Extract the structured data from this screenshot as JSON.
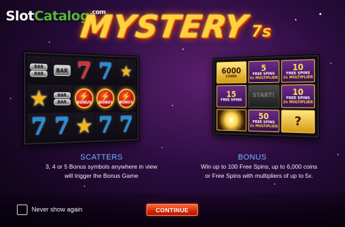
{
  "watermark": {
    "part1": "Slot",
    "part2": "Catalog",
    "part3": ".com"
  },
  "logo": {
    "title": "MYSTERY",
    "suffix": "7s"
  },
  "reels": {
    "bar_label": "BAR",
    "bonus_label": "BONUS"
  },
  "bonus_board": {
    "tiles": [
      {
        "big": "6000",
        "small": "COINS"
      },
      {
        "big": "5",
        "small": "FREE SPINS",
        "mult": "5x MULTIPLIER"
      },
      {
        "big": "10",
        "small": "FREE SPINS",
        "mult": "2x MULTIPLIER"
      },
      {
        "big": "15",
        "small": "FREE SPINS"
      },
      {
        "big": "START!"
      },
      {
        "big": "10",
        "small": "FREE SPINS",
        "mult": "2x MULTIPLIER"
      },
      {
        "big": ""
      },
      {
        "big": "50",
        "small": "FREE SPINS",
        "mult": "2x MULTIPLIER"
      },
      {
        "big": "?"
      }
    ]
  },
  "scatters": {
    "title": "SCATTERS",
    "line1": "3, 4 or 5 Bonus symbols anywhere in view",
    "line2": "will trigger the Bonus Game"
  },
  "bonus": {
    "title": "BONUS",
    "line1": "Win up to 100 Free Spins, up to 6,000 coins",
    "line2": "or Free Spins with multipliers of up to 5x."
  },
  "footer": {
    "never_show_label": "Never show again",
    "never_show_checked": false,
    "continue_label": "CONTINUE"
  },
  "colors": {
    "accent": "#6fb7ff",
    "button": "#e03212",
    "logo": "#ffd23a"
  }
}
